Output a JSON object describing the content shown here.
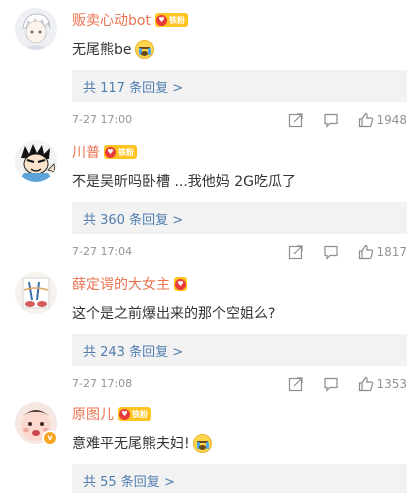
{
  "comments": [
    {
      "name": "贩卖心动bot",
      "fan_badge": "铁粉",
      "text": "无尾熊be",
      "emoji": "cry-emoji",
      "replies": "共 117 条回复 >",
      "time": "7-27 17:00",
      "likes": "1948"
    },
    {
      "name": "川普",
      "fan_badge": "铁粉",
      "text": "不是吴昕吗卧槽 ...我他妈 2G吃瓜了",
      "replies": "共 360 条回复 >",
      "time": "7-27 17:04",
      "likes": "1817"
    },
    {
      "name": "薛定谔的大女主",
      "fan_badge": "",
      "text": "这个是之前爆出来的那个空姐么?",
      "replies": "共 243 条回复 >",
      "time": "7-27 17:08",
      "likes": "1353"
    },
    {
      "name": "原图儿",
      "fan_badge": "铁粉",
      "text": "意难平无尾熊夫妇!",
      "emoji": "cry-emoji",
      "verified": "v",
      "replies": "共 55 条回复 >"
    }
  ],
  "colors": {
    "name": "#eb7350",
    "link": "#507daf",
    "meta": "#939393",
    "reply_bg": "#f2f2f2"
  }
}
